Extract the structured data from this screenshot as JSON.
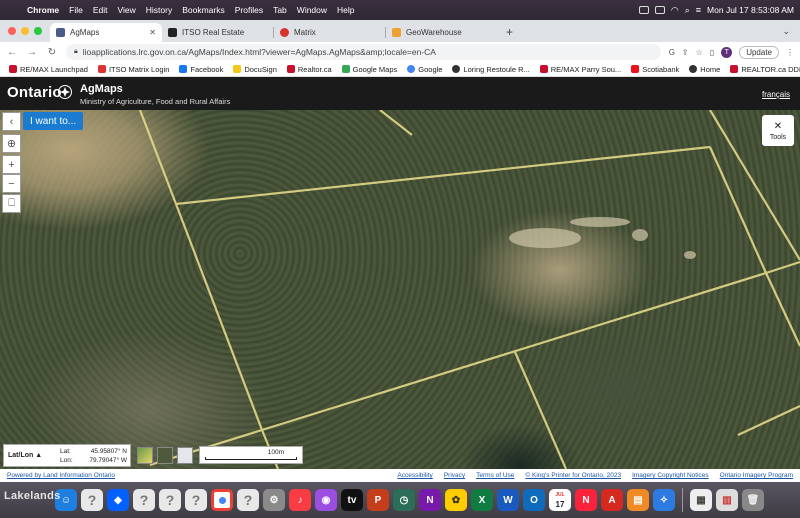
{
  "menubar": {
    "app": "Chrome",
    "items": [
      "File",
      "Edit",
      "View",
      "History",
      "Bookmarks",
      "Profiles",
      "Tab",
      "Window",
      "Help"
    ],
    "clock": "Mon Jul 17  8:53:08 AM"
  },
  "tabs": [
    {
      "label": "AgMaps",
      "color": "#4a5a8a",
      "active": true
    },
    {
      "label": "ITSO Real Estate",
      "color": "#222222",
      "active": false
    },
    {
      "label": "Matrix",
      "color": "#d8322b",
      "active": false
    },
    {
      "label": "GeoWarehouse",
      "color": "#f0a030",
      "active": false
    }
  ],
  "address": {
    "url": "lioapplications.lrc.gov.on.ca/AgMaps/Index.html?viewer=AgMaps.AgMaps&amp;locale=en-CA",
    "avatar": "T",
    "update_label": "Update"
  },
  "bookmarks": [
    {
      "label": "RE/MAX Launchpad",
      "color": "#c8102e"
    },
    {
      "label": "ITSO Matrix Login",
      "color": "#d33"
    },
    {
      "label": "Facebook",
      "color": "#1877f2"
    },
    {
      "label": "DocuSign",
      "color": "#f5c518"
    },
    {
      "label": "Realtor.ca",
      "color": "#c8102e"
    },
    {
      "label": "Google Maps",
      "color": "#34a853"
    },
    {
      "label": "Google",
      "color": "#4285f4"
    },
    {
      "label": "Loring Restoule R...",
      "color": "#333"
    },
    {
      "label": "RE/MAX Parry Sou...",
      "color": "#c8102e"
    },
    {
      "label": "Scotiabank",
      "color": "#ec111a"
    },
    {
      "label": "Home",
      "color": "#333"
    },
    {
      "label": "REALTOR.ca DDF...",
      "color": "#c8102e"
    }
  ],
  "header": {
    "logo": "Ontario",
    "title": "AgMaps",
    "subtitle": "Ministry of Agriculture, Food and Rural Affairs",
    "language_link": "français"
  },
  "map": {
    "i_want_to": "I want to...",
    "tools_label": "Tools",
    "coords": {
      "mode": "Lat/Lon",
      "lat_label": "Lat:",
      "lat_value": "45.95807° N",
      "lon_label": "Lon:",
      "lon_value": "79.79047° W"
    },
    "scale_label": "100m"
  },
  "footer": {
    "powered_by": "Powered by Land Information Ontario",
    "links": [
      "Accessibility",
      "Privacy",
      "Terms of Use",
      "© King's Printer for Ontario, 2023",
      "Imagery Copyright Notices",
      "Ontario Imagery Program"
    ]
  },
  "dock": {
    "calendar_day": "17",
    "calendar_month": "JUL"
  },
  "watermark": "Lakelands"
}
